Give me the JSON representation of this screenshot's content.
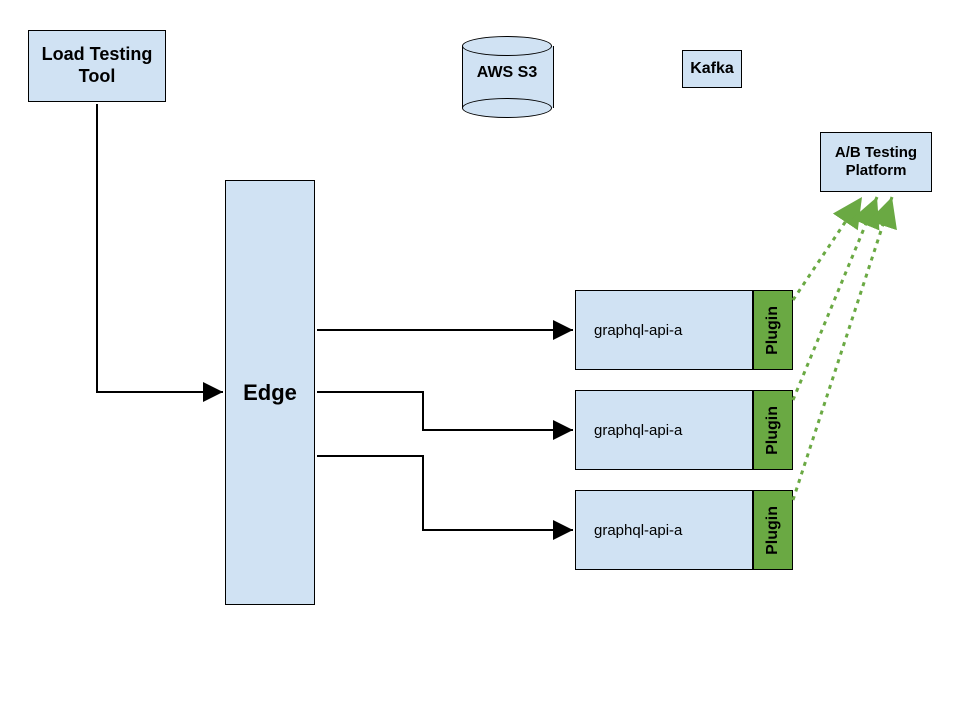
{
  "nodes": {
    "load_tool": "Load Testing Tool",
    "s3": "AWS S3",
    "kafka": "Kafka",
    "edge": "Edge",
    "ab_platform": "A/B Testing Platform",
    "api1": "graphql-api-a",
    "api2": "graphql-api-a",
    "api3": "graphql-api-a",
    "plugin1": "Plugin",
    "plugin2": "Plugin",
    "plugin3": "Plugin"
  },
  "colors": {
    "node_fill": "#d0e2f3",
    "plugin_fill": "#6aa943",
    "arrow_green": "#6aa943",
    "arrow_black": "#000000"
  },
  "diagram": {
    "type": "architecture",
    "edges": [
      {
        "from": "load_tool",
        "to": "edge",
        "style": "solid"
      },
      {
        "from": "edge",
        "to": "api1",
        "style": "solid"
      },
      {
        "from": "edge",
        "to": "api2",
        "style": "solid"
      },
      {
        "from": "edge",
        "to": "api3",
        "style": "solid"
      },
      {
        "from": "plugin1",
        "to": "ab_platform",
        "style": "dotted",
        "color": "green"
      },
      {
        "from": "plugin2",
        "to": "ab_platform",
        "style": "dotted",
        "color": "green"
      },
      {
        "from": "plugin3",
        "to": "ab_platform",
        "style": "dotted",
        "color": "green"
      }
    ]
  }
}
